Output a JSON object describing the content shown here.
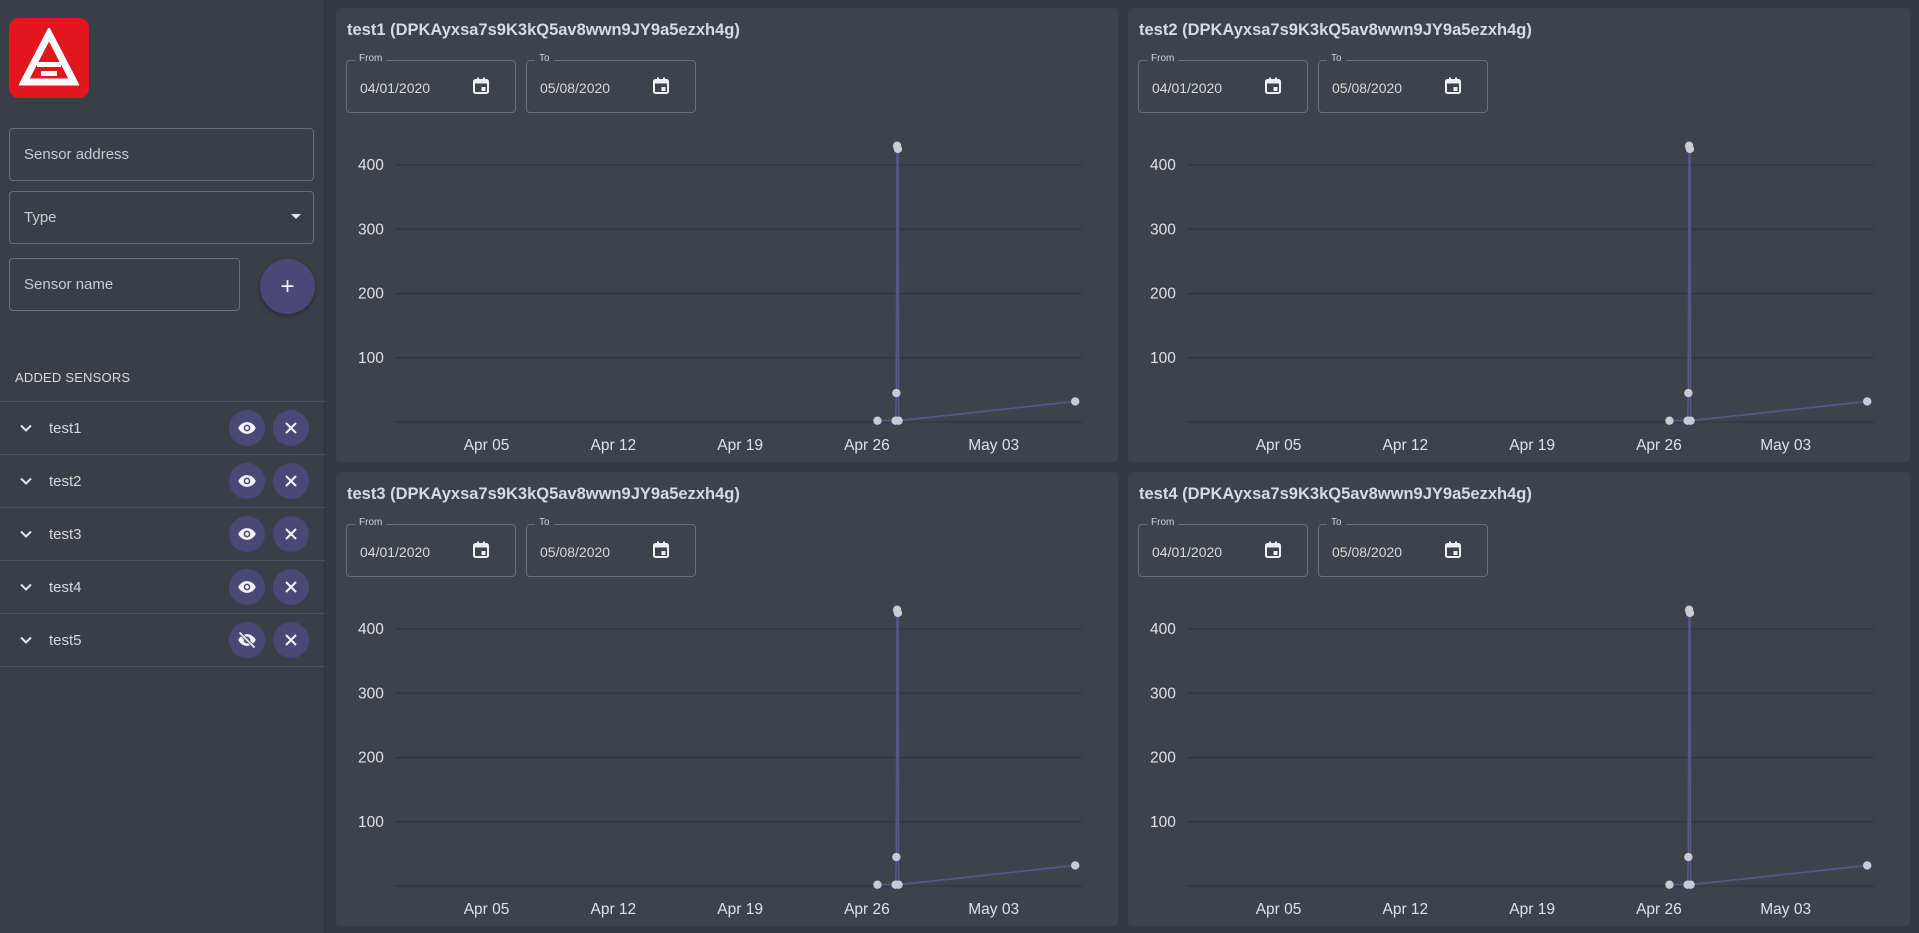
{
  "sidebar": {
    "logo_icon": "ark-logo",
    "address_placeholder": "Sensor address",
    "type_label": "Type",
    "name_placeholder": "Sensor name",
    "add_label": "+",
    "section_title": "ADDED SENSORS",
    "sensors": [
      {
        "name": "test1",
        "visible": true
      },
      {
        "name": "test2",
        "visible": true
      },
      {
        "name": "test3",
        "visible": true
      },
      {
        "name": "test4",
        "visible": true
      },
      {
        "name": "test5",
        "visible": false
      }
    ]
  },
  "colors": {
    "accent": "#4b4776",
    "line": "#5b5591",
    "point": "#c8cbd6",
    "logo_red": "#e2161e"
  },
  "cards": [
    {
      "title": "test1 (DPKAyxsa7s9K3kQ5av8wwn9JY9a5ezxh4g)",
      "from_label": "From",
      "from": "04/01/2020",
      "to_label": "To",
      "to": "05/08/2020"
    },
    {
      "title": "test2 (DPKAyxsa7s9K3kQ5av8wwn9JY9a5ezxh4g)",
      "from_label": "From",
      "from": "04/01/2020",
      "to_label": "To",
      "to": "05/08/2020"
    },
    {
      "title": "test3 (DPKAyxsa7s9K3kQ5av8wwn9JY9a5ezxh4g)",
      "from_label": "From",
      "from": "04/01/2020",
      "to_label": "To",
      "to": "05/08/2020"
    },
    {
      "title": "test4 (DPKAyxsa7s9K3kQ5av8wwn9JY9a5ezxh4g)",
      "from_label": "From",
      "from": "04/01/2020",
      "to_label": "To",
      "to": "05/08/2020"
    }
  ],
  "chart_data": [
    {
      "type": "line",
      "title": "test1 (DPKAyxsa7s9K3kQ5av8wwn9JY9a5ezxh4g)",
      "xlabel": "",
      "ylabel": "",
      "xticks": [
        "Apr 05",
        "Apr 12",
        "Apr 19",
        "Apr 26",
        "May 03"
      ],
      "yticks": [
        100,
        200,
        300,
        400
      ],
      "xlim": [
        "2020-03-31",
        "2020-05-07"
      ],
      "ylim": [
        0,
        430
      ],
      "grid": true,
      "points": [
        {
          "x": "2020-04-26 14:00",
          "y": 2
        },
        {
          "x": "2020-04-27 14:00",
          "y": 2
        },
        {
          "x": "2020-04-27 15:00",
          "y": 45
        },
        {
          "x": "2020-04-27 16:00",
          "y": 430
        },
        {
          "x": "2020-04-27 17:00",
          "y": 425
        },
        {
          "x": "2020-04-27 18:00",
          "y": 2
        },
        {
          "x": "2020-05-07 12:00",
          "y": 32
        }
      ]
    },
    {
      "type": "line",
      "title": "test2 (DPKAyxsa7s9K3kQ5av8wwn9JY9a5ezxh4g)",
      "xlabel": "",
      "ylabel": "",
      "xticks": [
        "Apr 05",
        "Apr 12",
        "Apr 19",
        "Apr 26",
        "May 03"
      ],
      "yticks": [
        100,
        200,
        300,
        400
      ],
      "xlim": [
        "2020-03-31",
        "2020-05-07"
      ],
      "ylim": [
        0,
        430
      ],
      "grid": true,
      "points": [
        {
          "x": "2020-04-26 14:00",
          "y": 2
        },
        {
          "x": "2020-04-27 14:00",
          "y": 2
        },
        {
          "x": "2020-04-27 15:00",
          "y": 45
        },
        {
          "x": "2020-04-27 16:00",
          "y": 430
        },
        {
          "x": "2020-04-27 17:00",
          "y": 425
        },
        {
          "x": "2020-04-27 18:00",
          "y": 2
        },
        {
          "x": "2020-05-07 12:00",
          "y": 32
        }
      ]
    },
    {
      "type": "line",
      "title": "test3 (DPKAyxsa7s9K3kQ5av8wwn9JY9a5ezxh4g)",
      "xlabel": "",
      "ylabel": "",
      "xticks": [
        "Apr 05",
        "Apr 12",
        "Apr 19",
        "Apr 26",
        "May 03"
      ],
      "yticks": [
        100,
        200,
        300,
        400
      ],
      "xlim": [
        "2020-03-31",
        "2020-05-07"
      ],
      "ylim": [
        0,
        430
      ],
      "grid": true,
      "points": [
        {
          "x": "2020-04-26 14:00",
          "y": 2
        },
        {
          "x": "2020-04-27 14:00",
          "y": 2
        },
        {
          "x": "2020-04-27 15:00",
          "y": 45
        },
        {
          "x": "2020-04-27 16:00",
          "y": 430
        },
        {
          "x": "2020-04-27 17:00",
          "y": 425
        },
        {
          "x": "2020-04-27 18:00",
          "y": 2
        },
        {
          "x": "2020-05-07 12:00",
          "y": 32
        }
      ]
    },
    {
      "type": "line",
      "title": "test4 (DPKAyxsa7s9K3kQ5av8wwn9JY9a5ezxh4g)",
      "xlabel": "",
      "ylabel": "",
      "xticks": [
        "Apr 05",
        "Apr 12",
        "Apr 19",
        "Apr 26",
        "May 03"
      ],
      "yticks": [
        100,
        200,
        300,
        400
      ],
      "xlim": [
        "2020-03-31",
        "2020-05-07"
      ],
      "ylim": [
        0,
        430
      ],
      "grid": true,
      "points": [
        {
          "x": "2020-04-26 14:00",
          "y": 2
        },
        {
          "x": "2020-04-27 14:00",
          "y": 2
        },
        {
          "x": "2020-04-27 15:00",
          "y": 45
        },
        {
          "x": "2020-04-27 16:00",
          "y": 430
        },
        {
          "x": "2020-04-27 17:00",
          "y": 425
        },
        {
          "x": "2020-04-27 18:00",
          "y": 2
        },
        {
          "x": "2020-05-07 12:00",
          "y": 32
        }
      ]
    }
  ]
}
